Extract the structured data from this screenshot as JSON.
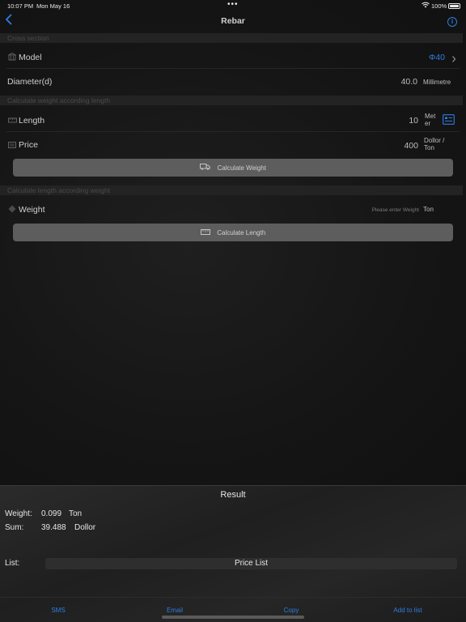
{
  "status": {
    "time": "10:07 PM",
    "date": "Mon May 16",
    "battery": "100%",
    "wifi_icon": "wifi-icon"
  },
  "nav": {
    "title": "Rebar",
    "back_icon": "chevron-left-icon",
    "info_icon": "info-icon"
  },
  "sections": {
    "cross_section": "Cross section",
    "weight_by_length": "Calculate weight according length",
    "length_by_weight": "Calculate length according weight"
  },
  "model": {
    "label": "Model",
    "value": "Φ40"
  },
  "diameter": {
    "label": "Diameter(d)",
    "value": "40.0",
    "unit": "Millimetre"
  },
  "length": {
    "label": "Length",
    "value": "10",
    "unit_line1": "Met",
    "unit_line2": "er"
  },
  "price": {
    "label": "Price",
    "value": "400",
    "unit_line1": "Dollor /",
    "unit_line2": "Ton"
  },
  "calc_weight_button": "Calculate Weight",
  "weight": {
    "label": "Weight",
    "placeholder": "Please enter Weight",
    "unit": "Ton"
  },
  "calc_length_button": "Calculate Length",
  "result": {
    "title": "Result",
    "weight_label": "Weight:",
    "weight_value": "0.099",
    "weight_unit": "Ton",
    "sum_label": "Sum:",
    "sum_value": "39.488",
    "sum_unit": "Dollor",
    "list_label": "List:",
    "price_list": "Price List"
  },
  "footer": {
    "sms": "SMS",
    "email": "Email",
    "copy": "Copy",
    "add": "Add to list"
  },
  "colors": {
    "accent": "#2f7de1",
    "background": "#141414",
    "button": "#5d5d5d"
  }
}
